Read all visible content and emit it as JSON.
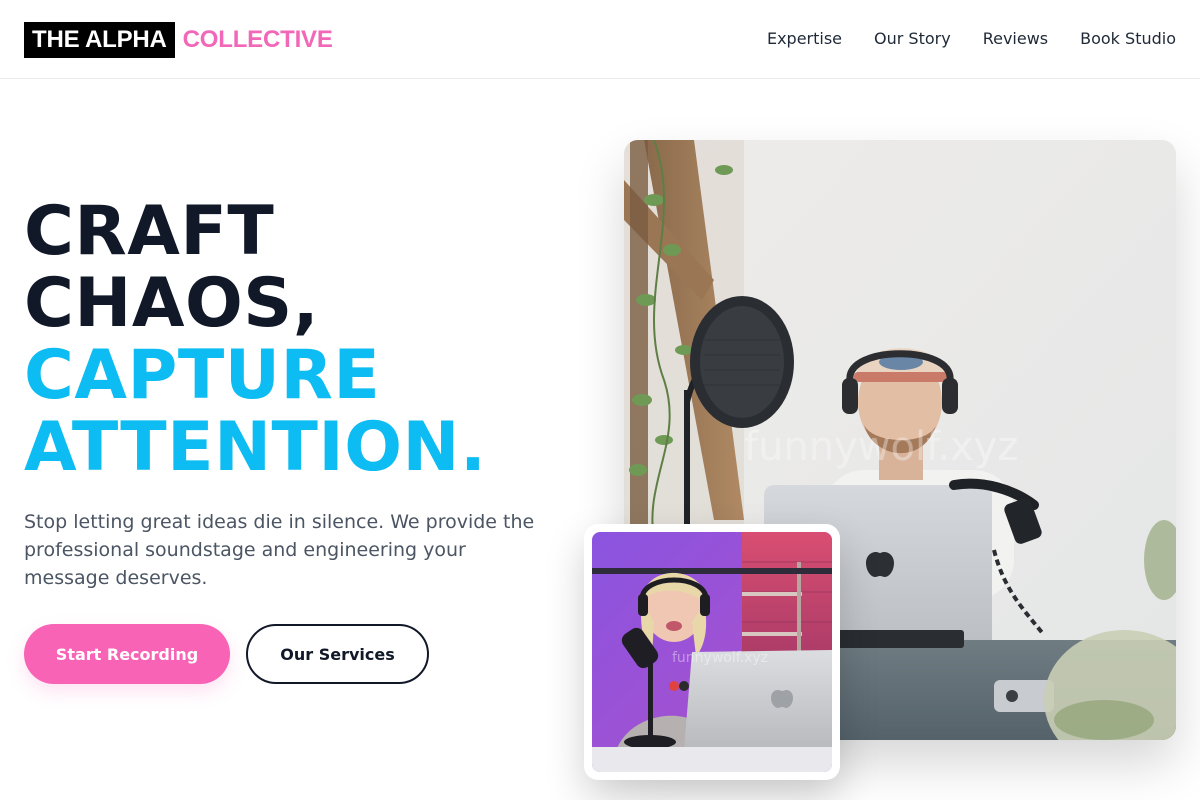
{
  "brand": {
    "name": "THE ALPHA",
    "accent": "COLLECTIVE",
    "accent_color": "#f268b8"
  },
  "nav": {
    "items": [
      {
        "label": "Expertise"
      },
      {
        "label": "Our Story"
      },
      {
        "label": "Reviews"
      },
      {
        "label": "Book Studio"
      }
    ]
  },
  "hero": {
    "headline_dark_1": "CRAFT",
    "headline_dark_2": "CHAOS,",
    "headline_accent_1": "CAPTURE",
    "headline_accent_2": "ATTENTION.",
    "accent_color": "#0cbcf2",
    "lede": "Stop letting great ideas die in silence. We provide the professional soundstage and engineering your message deserves.",
    "primary_cta": "Start Recording",
    "primary_color": "#f863b5",
    "secondary_cta": "Our Services"
  },
  "images": {
    "main_watermark": "funnywolf.xyz",
    "inset_watermark": "funnywolf.xyz"
  }
}
